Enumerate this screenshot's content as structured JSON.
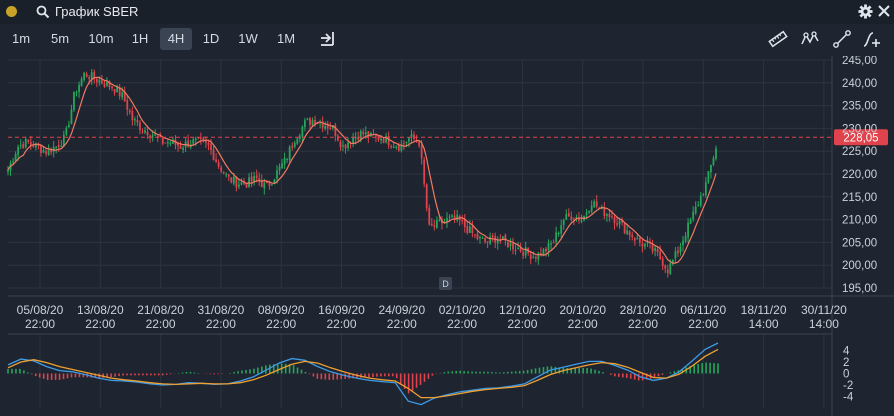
{
  "window": {
    "title": "График SBER"
  },
  "toolbar": {
    "timeframes": [
      "1m",
      "5m",
      "10m",
      "1H",
      "4H",
      "1D",
      "1W",
      "1M"
    ],
    "active_timeframe": "4H"
  },
  "colors": {
    "up": "#26a65b",
    "down": "#e0434b",
    "ma": "#f07a62",
    "macd": "#3d9be9",
    "signal": "#f0a030",
    "price_badge": "#e0434b"
  },
  "chart_data": [
    {
      "type": "candlestick",
      "title": "",
      "ylim": [
        195,
        245
      ],
      "y_ticks": [
        "245,00",
        "240,00",
        "235,00",
        "230,00",
        "225,00",
        "220,00",
        "215,00",
        "210,00",
        "205,00",
        "200,00",
        "195,00"
      ],
      "x_ticks": [
        [
          "05/08/20",
          "22:00"
        ],
        [
          "13/08/20",
          "22:00"
        ],
        [
          "21/08/20",
          "22:00"
        ],
        [
          "31/08/20",
          "22:00"
        ],
        [
          "08/09/20",
          "22:00"
        ],
        [
          "16/09/20",
          "22:00"
        ],
        [
          "24/09/20",
          "22:00"
        ],
        [
          "02/10/20",
          "22:00"
        ],
        [
          "12/10/20",
          "22:00"
        ],
        [
          "20/10/20",
          "22:00"
        ],
        [
          "28/10/20",
          "22:00"
        ],
        [
          "06/11/20",
          "22:00"
        ],
        [
          "18/11/20",
          "14:00"
        ],
        [
          "30/11/20",
          "14:00"
        ]
      ],
      "last_price": 228.05,
      "last_price_label": "228,05",
      "marker_label": "D",
      "close_path": [
        221,
        226,
        227,
        226,
        225,
        226,
        228,
        238,
        242,
        241,
        240,
        239,
        237,
        232,
        230,
        229,
        227,
        227,
        226,
        227,
        227,
        226,
        222,
        219,
        218,
        218,
        219,
        217,
        220,
        223,
        228,
        231,
        232,
        231,
        230,
        226,
        228,
        229,
        228,
        228,
        227,
        226,
        228,
        227,
        208,
        209,
        210,
        210,
        208,
        206,
        205,
        206,
        205,
        204,
        203,
        202,
        203,
        205,
        210,
        211,
        210,
        214,
        212,
        211,
        209,
        207,
        205,
        204,
        202,
        199,
        203,
        208,
        213,
        218,
        226
      ]
    },
    {
      "type": "line",
      "ylim": [
        -6,
        6
      ],
      "y_ticks": [
        "4",
        "2",
        "0",
        "-2",
        "-4"
      ],
      "series": [
        {
          "values": [
            1.5,
            2.5,
            2.2,
            1.2,
            0.5,
            0.3,
            -0.2,
            -0.8,
            -1.2,
            -1.3,
            -1.5,
            -1.8,
            -2.0,
            -1.9,
            -1.6,
            -1.7,
            -1.9,
            -1.8,
            -1.3,
            -0.6,
            0.6,
            1.8,
            2.6,
            2.3,
            1.2,
            0.3,
            -0.3,
            -0.8,
            -1.2,
            -1.4,
            -1.6,
            -4.8,
            -5.4,
            -4.3,
            -3.7,
            -3.2,
            -2.9,
            -2.6,
            -2.5,
            -2.2,
            -1.8,
            -0.6,
            0.6,
            1.1,
            1.6,
            2.1,
            2.1,
            1.4,
            0.6,
            -0.6,
            -1.2,
            -0.8,
            0.3,
            2.2,
            4.2,
            5.3
          ]
        },
        {
          "values": [
            1.0,
            2.0,
            2.4,
            1.9,
            1.2,
            0.7,
            0.2,
            -0.3,
            -0.8,
            -1.1,
            -1.3,
            -1.6,
            -1.8,
            -1.9,
            -1.8,
            -1.7,
            -1.8,
            -1.8,
            -1.6,
            -1.1,
            -0.3,
            0.7,
            1.6,
            2.1,
            1.8,
            1.0,
            0.3,
            -0.3,
            -0.8,
            -1.1,
            -1.3,
            -2.6,
            -4.2,
            -4.2,
            -3.9,
            -3.5,
            -3.1,
            -2.8,
            -2.6,
            -2.4,
            -2.1,
            -1.2,
            -0.2,
            0.5,
            1.0,
            1.5,
            1.9,
            1.7,
            1.1,
            0.2,
            -0.7,
            -0.8,
            -0.1,
            1.3,
            3.0,
            4.2
          ]
        }
      ]
    }
  ]
}
